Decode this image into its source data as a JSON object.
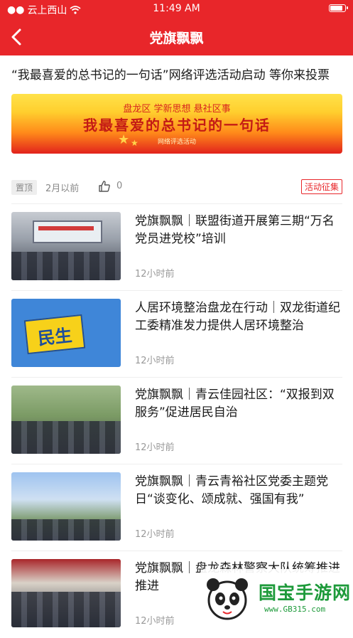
{
  "status_bar": {
    "carrier": "云上西山",
    "time": "11:49 AM"
  },
  "navbar": {
    "title": "党旗飘飘"
  },
  "featured": {
    "title": "“我最喜爱的总书记的一句话”网络评选活动启动 等你来投票",
    "banner": {
      "line1": "盘龙区 学新思想 悬社区事",
      "line2": "我最喜爱的总书记的一句话",
      "line3": "网络评选活动"
    },
    "pin_label": "置顶",
    "time": "2月以前",
    "likes": "0",
    "tag": "活动征集"
  },
  "news": [
    {
      "title": "党旗飘飘｜联盟街道开展第三期“万名党员进党校”培训",
      "time": "12小时前",
      "thumb": "meeting-photo"
    },
    {
      "title": "人居环境整治盘龙在行动｜双龙街道纪工委精准发力提供人居环境整治",
      "time": "12小时前",
      "thumb": "minsheng-graphic",
      "thumb_text": "民生"
    },
    {
      "title": "党旗飘飘｜青云佳园社区：“双报到双服务”促进居民自治",
      "time": "12小时前",
      "thumb": "outdoor-group-photo"
    },
    {
      "title": "党旗飘飘｜青云青裕社区党委主题党日“谈变化、颂成就、强国有我”",
      "time": "12小时前",
      "thumb": "outdoor-activity-photo"
    },
    {
      "title": "党旗飘飘｜盘龙森林警察大队统筹推进推进",
      "time": "12小时前",
      "thumb": "police-meeting-photo"
    }
  ],
  "watermark": {
    "name": "国宝手游网",
    "url": "www.GB315.com"
  },
  "colors": {
    "brand_red": "#e8262a",
    "watermark_green": "#1d9a3a"
  }
}
